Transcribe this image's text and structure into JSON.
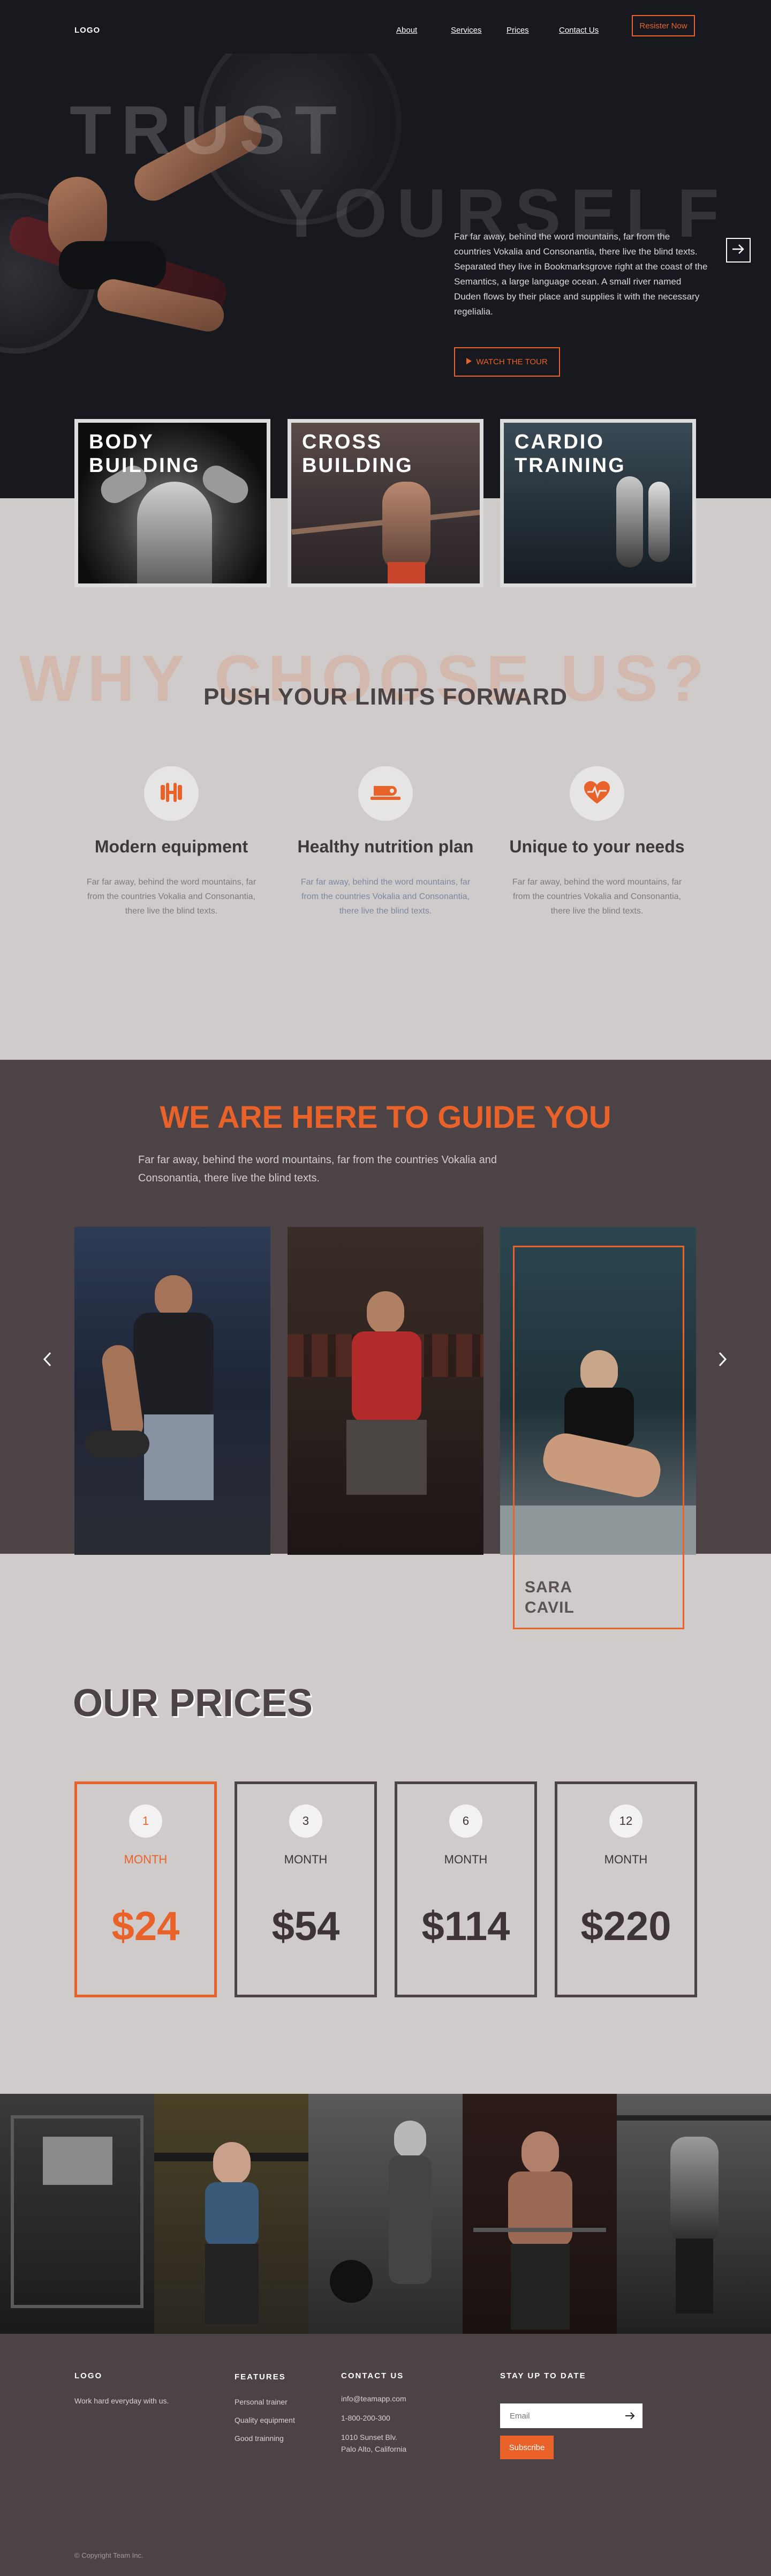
{
  "colors": {
    "accent": "#e8622a",
    "dark": "#17191e",
    "panel": "#4b4345",
    "light_bg": "#cfcbcb"
  },
  "nav": {
    "logo": "LOGO",
    "links": [
      "About",
      "Services",
      "Prices",
      "Contact Us"
    ],
    "register": "Resister  Now"
  },
  "hero": {
    "word1": "TRUST",
    "word2": "YOURSELF",
    "paragraph1": "Far far away, behind the word mountains, far from the countries Vokalia and Consonantia, there live the blind texts.",
    "paragraph2": "Separated they live in Bookmarksgrove right at the coast of the Semantics, a large language ocean. A small river named Duden flows by their place and supplies it with the necessary regelialia.",
    "tour_button": "WATCH THE TOUR",
    "tour_icon": "play-icon",
    "next_icon": "arrow-right-icon"
  },
  "services": [
    {
      "title": "BODY BUILDING"
    },
    {
      "title": "CROSS BUILDING"
    },
    {
      "title": "CARDIO TRAINING"
    }
  ],
  "why": {
    "ghost": "WHY CHOOSE US?",
    "title": "PUSH YOUR LIMITS FORWARD",
    "features": [
      {
        "icon": "dumbbell-icon",
        "title": "Modern equipment",
        "text": "Far far away, behind the word mountains, far from the countries Vokalia and Consonantia, there live the blind texts."
      },
      {
        "icon": "apple-icon",
        "title": "Healthy nutrition plan",
        "text": "Far far away, behind the word mountains, far from the countries Vokalia and Consonantia, there live the blind texts."
      },
      {
        "icon": "heartbeat-icon",
        "title": "Unique to your needs",
        "text": "Far far away, behind the word mountains, far from the countries Vokalia and Consonantia, there live the blind texts."
      }
    ]
  },
  "guide": {
    "title": "WE ARE HERE TO GUIDE YOU",
    "text": "Far far away, behind the word mountains, far from the countries Vokalia and Consonantia, there live the blind texts.",
    "prev_icon": "chevron-left-icon",
    "next_icon": "chevron-right-icon",
    "featured_name": "SARA\nCAVIL"
  },
  "prices": {
    "title": "OUR PRICES",
    "plans": [
      {
        "count": "1",
        "unit": "MONTH",
        "price": "$24",
        "active": true
      },
      {
        "count": "3",
        "unit": "MONTH",
        "price": "$54",
        "active": false
      },
      {
        "count": "6",
        "unit": "MONTH",
        "price": "$114",
        "active": false
      },
      {
        "count": "12",
        "unit": "MONTH",
        "price": "$220",
        "active": false
      }
    ]
  },
  "footer": {
    "logo": "LOGO",
    "tagline": "Work hard everyday with us.",
    "features_head": "FEATURES",
    "features": [
      "Personal  trainer",
      "Quality equipment",
      "Good trainning"
    ],
    "contact_head": "CONTACT US",
    "email": "info@teamapp.com",
    "phone": "1-800-200-300",
    "address": "1010 Sunset Blv.\nPalo Alto, California",
    "stay_head": "STAY UP TO DATE",
    "email_placeholder": "Email",
    "subscribe": "Subscribe",
    "copyright": "© Copyright Team Inc."
  }
}
